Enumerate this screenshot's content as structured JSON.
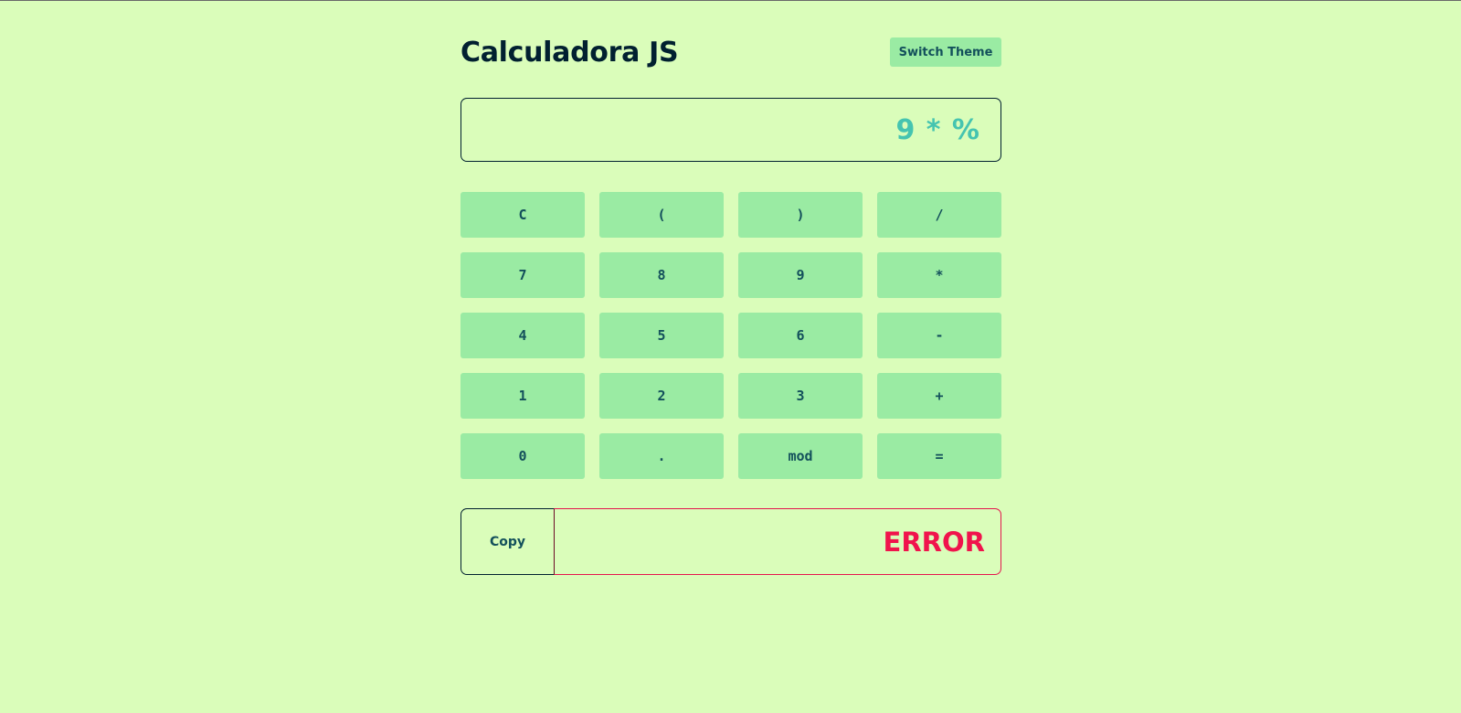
{
  "app": {
    "title": "Calculadora JS",
    "theme_button": "Switch Theme"
  },
  "display": {
    "expression": "9 * %"
  },
  "keypad": {
    "keys": [
      "C",
      "(",
      ")",
      "/",
      "7",
      "8",
      "9",
      "*",
      "4",
      "5",
      "6",
      "-",
      "1",
      "2",
      "3",
      "+",
      "0",
      ".",
      "mod",
      "="
    ]
  },
  "result": {
    "copy_label": "Copy",
    "value": "ERROR"
  },
  "colors": {
    "background": "#dafdba",
    "button": "#9aeba3",
    "button_text": "#13505b",
    "title": "#012030",
    "expression": "#45c4b0",
    "error": "#f0144c"
  }
}
